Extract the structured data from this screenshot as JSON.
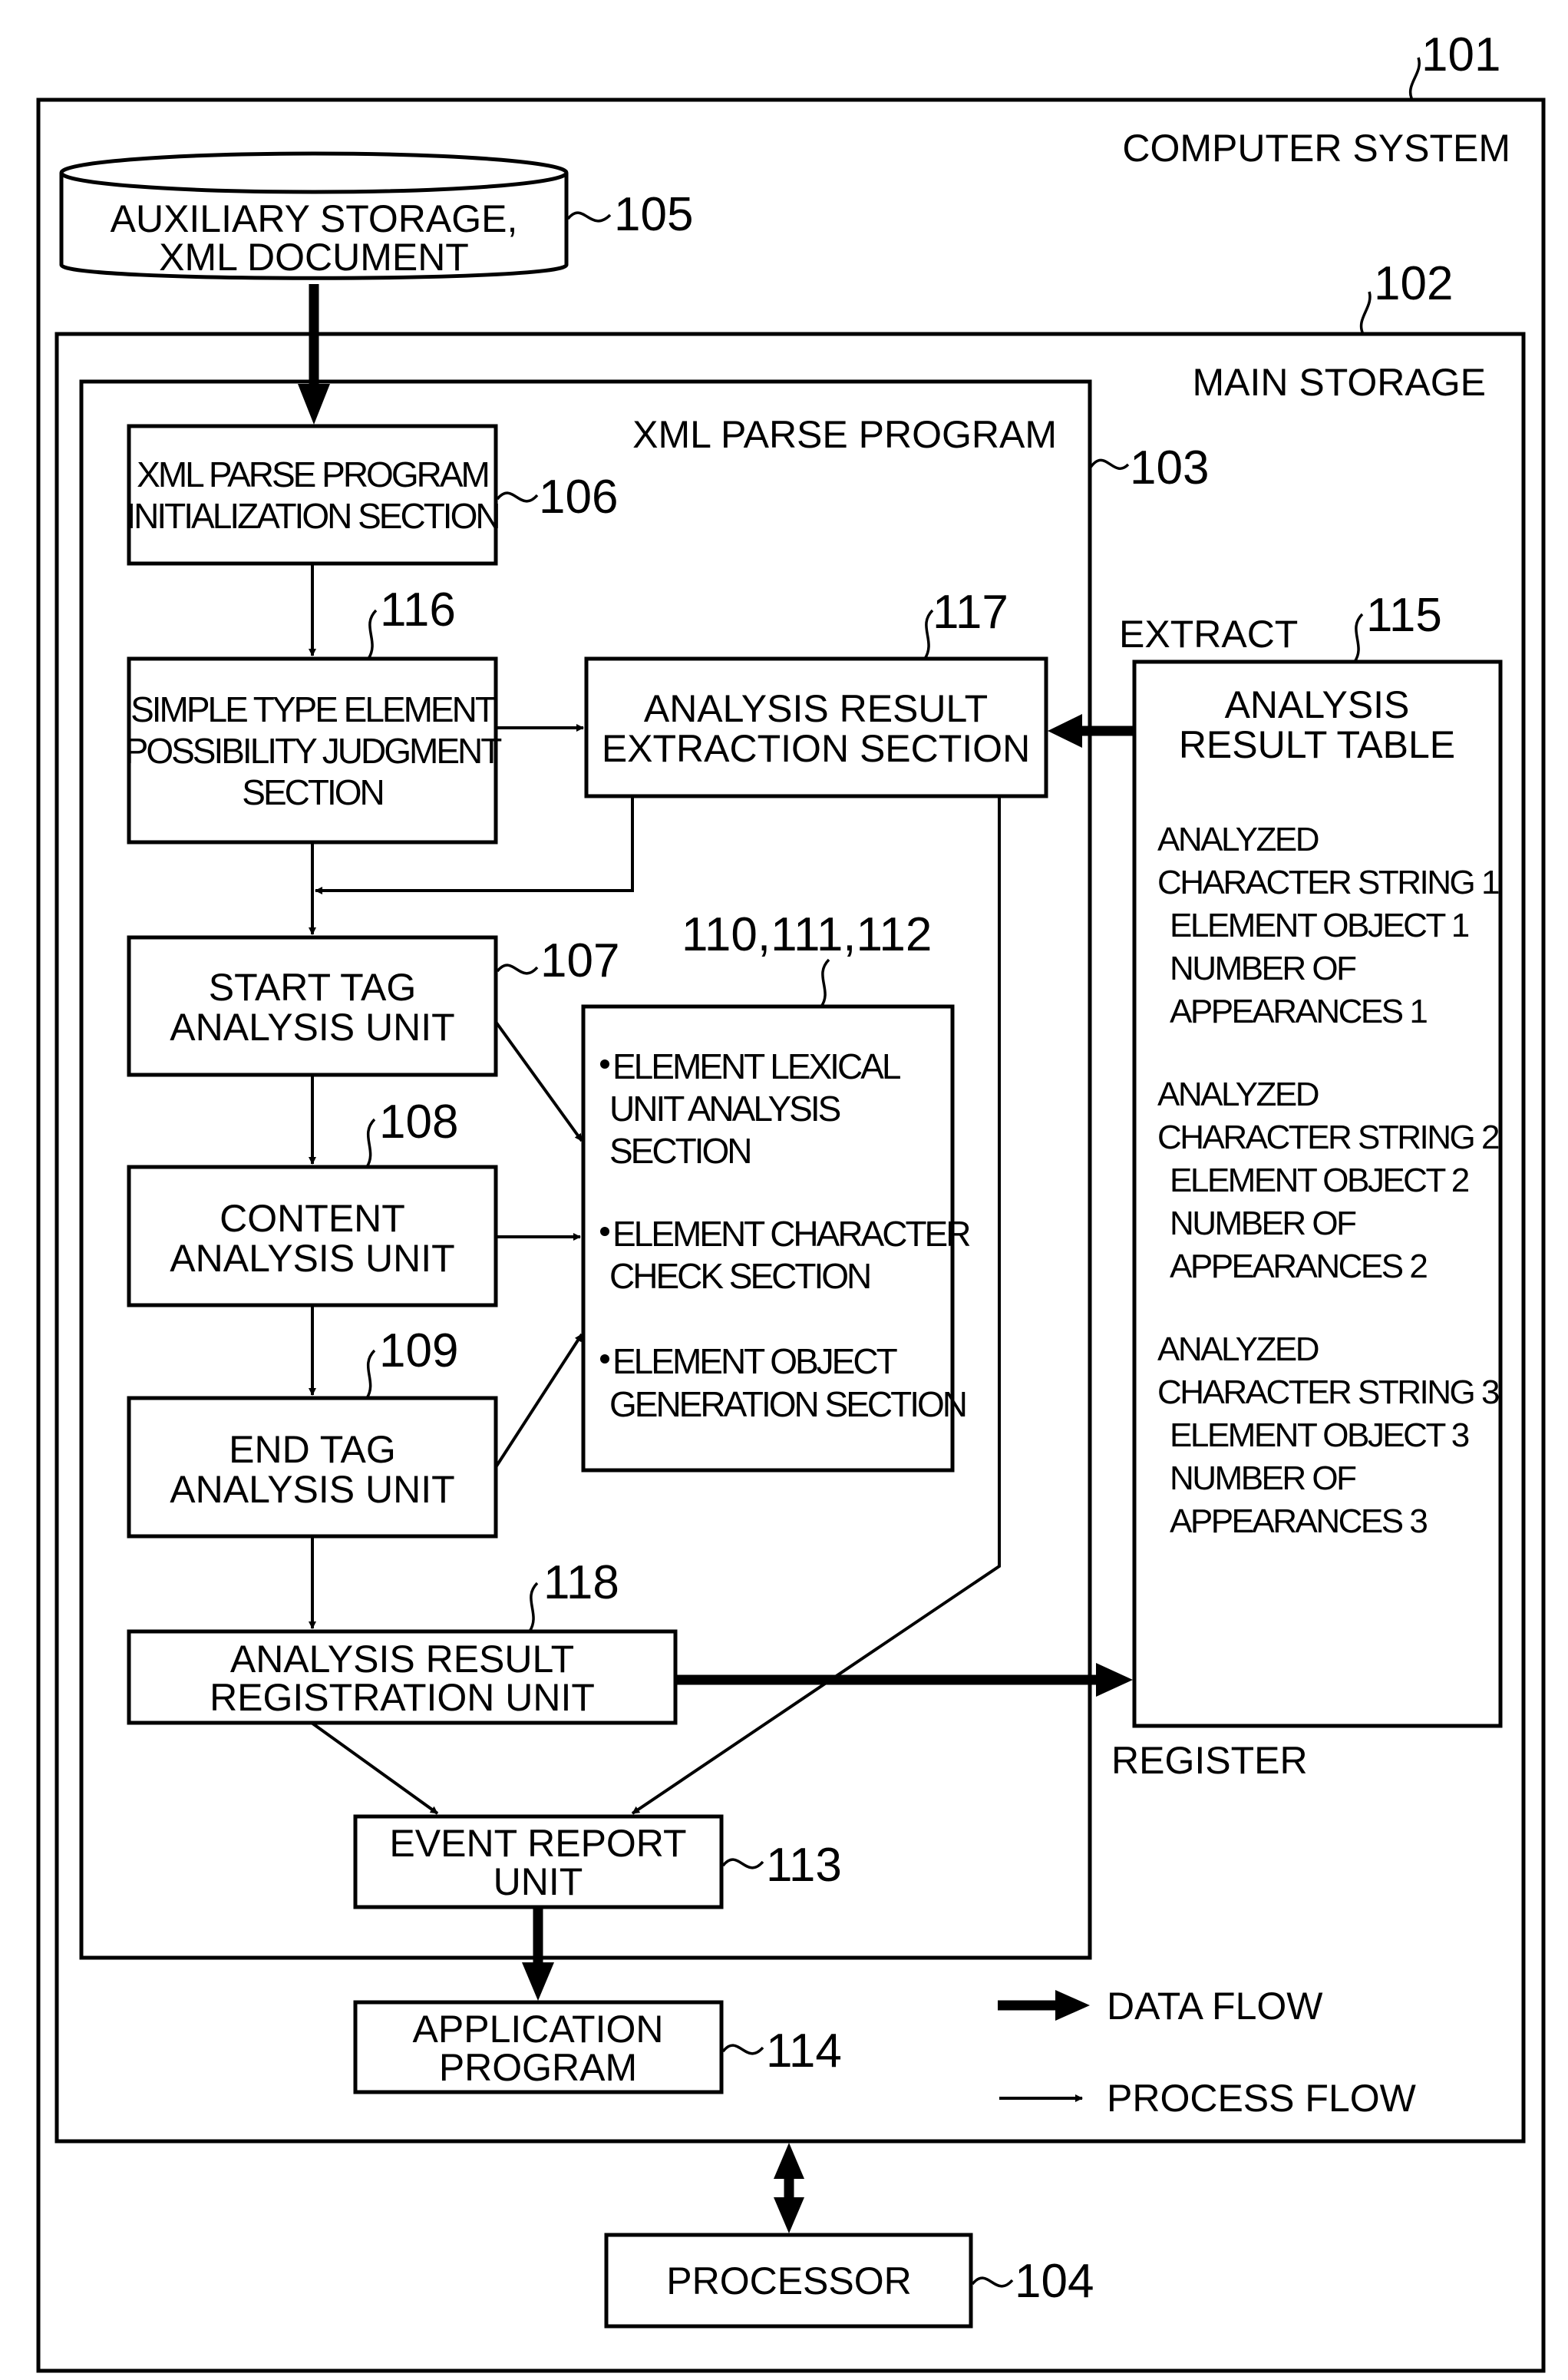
{
  "colors": {
    "ink": "#000000",
    "paper": "#ffffff"
  },
  "containers": {
    "computer_system": {
      "ref": "101",
      "label": "COMPUTER SYSTEM"
    },
    "main_storage": {
      "ref": "102",
      "label": "MAIN STORAGE"
    },
    "xml_parse_program": {
      "ref": "103",
      "label": "XML PARSE PROGRAM"
    }
  },
  "nodes": {
    "auxiliary_storage": {
      "ref": "105",
      "lines": [
        "AUXILIARY STORAGE,",
        "XML DOCUMENT"
      ]
    },
    "initialization": {
      "ref": "106",
      "lines": [
        "XML PARSE PROGRAM",
        "INITIALIZATION SECTION"
      ]
    },
    "simple_type": {
      "ref": "116",
      "lines": [
        "SIMPLE TYPE ELEMENT",
        "POSSIBILITY JUDGMENT",
        "SECTION"
      ]
    },
    "extraction": {
      "ref": "117",
      "lines": [
        "ANALYSIS RESULT",
        "EXTRACTION SECTION"
      ]
    },
    "start_tag": {
      "ref": "107",
      "lines": [
        "START TAG",
        "ANALYSIS UNIT"
      ]
    },
    "content": {
      "ref": "108",
      "lines": [
        "CONTENT",
        "ANALYSIS UNIT"
      ]
    },
    "end_tag": {
      "ref": "109",
      "lines": [
        "END TAG",
        "ANALYSIS UNIT"
      ]
    },
    "sections": {
      "ref": "110,111,112",
      "items": [
        {
          "lines": [
            "ELEMENT LEXICAL",
            "UNIT ANALYSIS",
            "SECTION"
          ]
        },
        {
          "lines": [
            "ELEMENT CHARACTER",
            "CHECK SECTION"
          ]
        },
        {
          "lines": [
            "ELEMENT OBJECT",
            "GENERATION SECTION"
          ]
        }
      ]
    },
    "registration": {
      "ref": "118",
      "lines": [
        "ANALYSIS RESULT",
        "REGISTRATION UNIT"
      ]
    },
    "event_report": {
      "ref": "113",
      "lines": [
        "EVENT REPORT",
        "UNIT"
      ]
    },
    "application": {
      "ref": "114",
      "lines": [
        "APPLICATION",
        "PROGRAM"
      ]
    },
    "processor": {
      "ref": "104",
      "lines": [
        "PROCESSOR"
      ]
    },
    "analysis_table": {
      "ref": "115",
      "title": [
        "ANALYSIS",
        "RESULT TABLE"
      ],
      "entries": [
        {
          "lines": [
            "ANALYZED",
            "CHARACTER STRING 1",
            "ELEMENT OBJECT 1",
            "NUMBER OF",
            "APPEARANCES 1"
          ]
        },
        {
          "lines": [
            "ANALYZED",
            "CHARACTER STRING 2",
            "ELEMENT OBJECT 2",
            "NUMBER OF",
            "APPEARANCES 2"
          ]
        },
        {
          "lines": [
            "ANALYZED",
            "CHARACTER STRING 3",
            "ELEMENT OBJECT 3",
            "NUMBER OF",
            "APPEARANCES 3"
          ]
        }
      ]
    }
  },
  "edge_labels": {
    "extract": "EXTRACT",
    "register": "REGISTER"
  },
  "legend": {
    "data_flow": "DATA FLOW",
    "process_flow": "PROCESS FLOW"
  }
}
